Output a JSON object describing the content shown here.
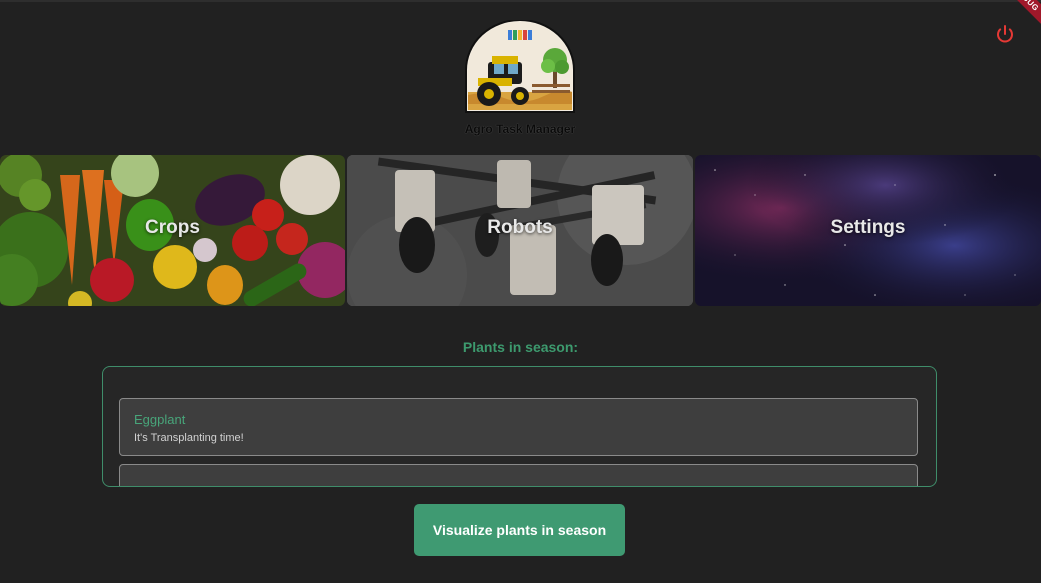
{
  "app": {
    "title": "Agro Task Manager",
    "debug_banner": "DEBUG"
  },
  "header": {
    "power_icon": "power-icon",
    "power_color": "#e53935"
  },
  "cards": [
    {
      "label": "Crops",
      "image": "vegetables-photo"
    },
    {
      "label": "Robots",
      "image": "farm-robot-photo"
    },
    {
      "label": "Settings",
      "image": "galaxy-photo"
    }
  ],
  "season": {
    "title": "Plants in season:",
    "items": [
      {
        "name": "Eggplant",
        "status": "It's Transplanting time!"
      },
      {
        "name": "",
        "status": ""
      }
    ],
    "accent": "#3d9a6e"
  },
  "actions": {
    "visualize_label": "Visualize plants in season"
  }
}
